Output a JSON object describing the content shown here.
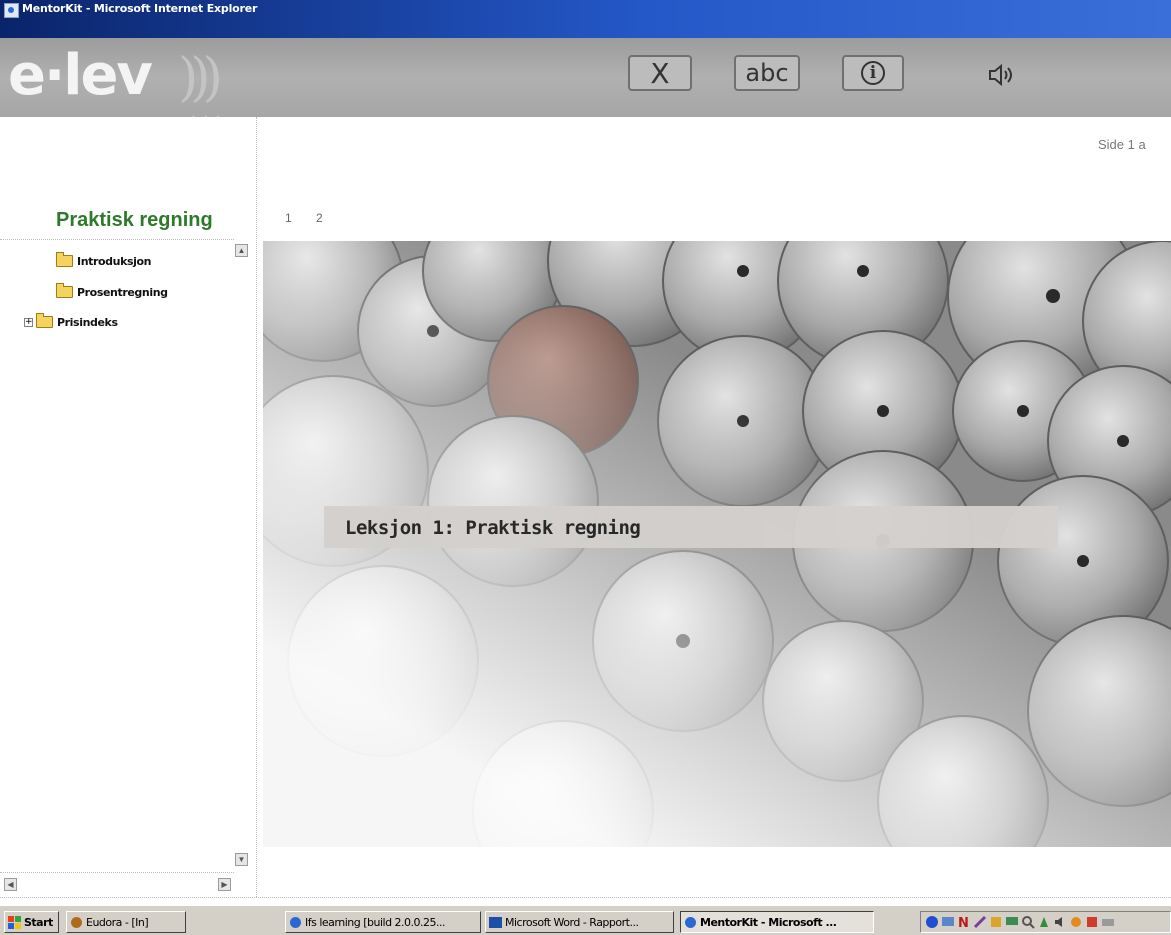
{
  "window": {
    "title": "MentorKit - Microsoft Internet Explorer"
  },
  "header": {
    "logo_text": "e·lev",
    "buttons": {
      "close": "X",
      "abc": "abc",
      "info": "i"
    }
  },
  "sidebar": {
    "course_title": "Praktisk regning",
    "tree": [
      {
        "label": "Introduksjon",
        "icon": "open-folder-icon"
      },
      {
        "label": "Prosentregning",
        "icon": "folder-icon"
      },
      {
        "label": "Prisindeks",
        "icon": "folder-icon",
        "expandable": true,
        "expander": "+"
      }
    ]
  },
  "main": {
    "page_indicator": "Side 1 a",
    "page_tabs": [
      "1",
      "2"
    ],
    "lesson_title": "Leksjon 1: Praktisk regning"
  },
  "taskbar": {
    "start_label": "Start",
    "buttons": [
      {
        "label": "Eudora - [In]"
      },
      {
        "label": "Ifs learning [build 2.0.0.25..."
      },
      {
        "label": "Microsoft Word - Rapport..."
      },
      {
        "label": "MentorKit - Microsoft ...",
        "active": true
      }
    ]
  }
}
